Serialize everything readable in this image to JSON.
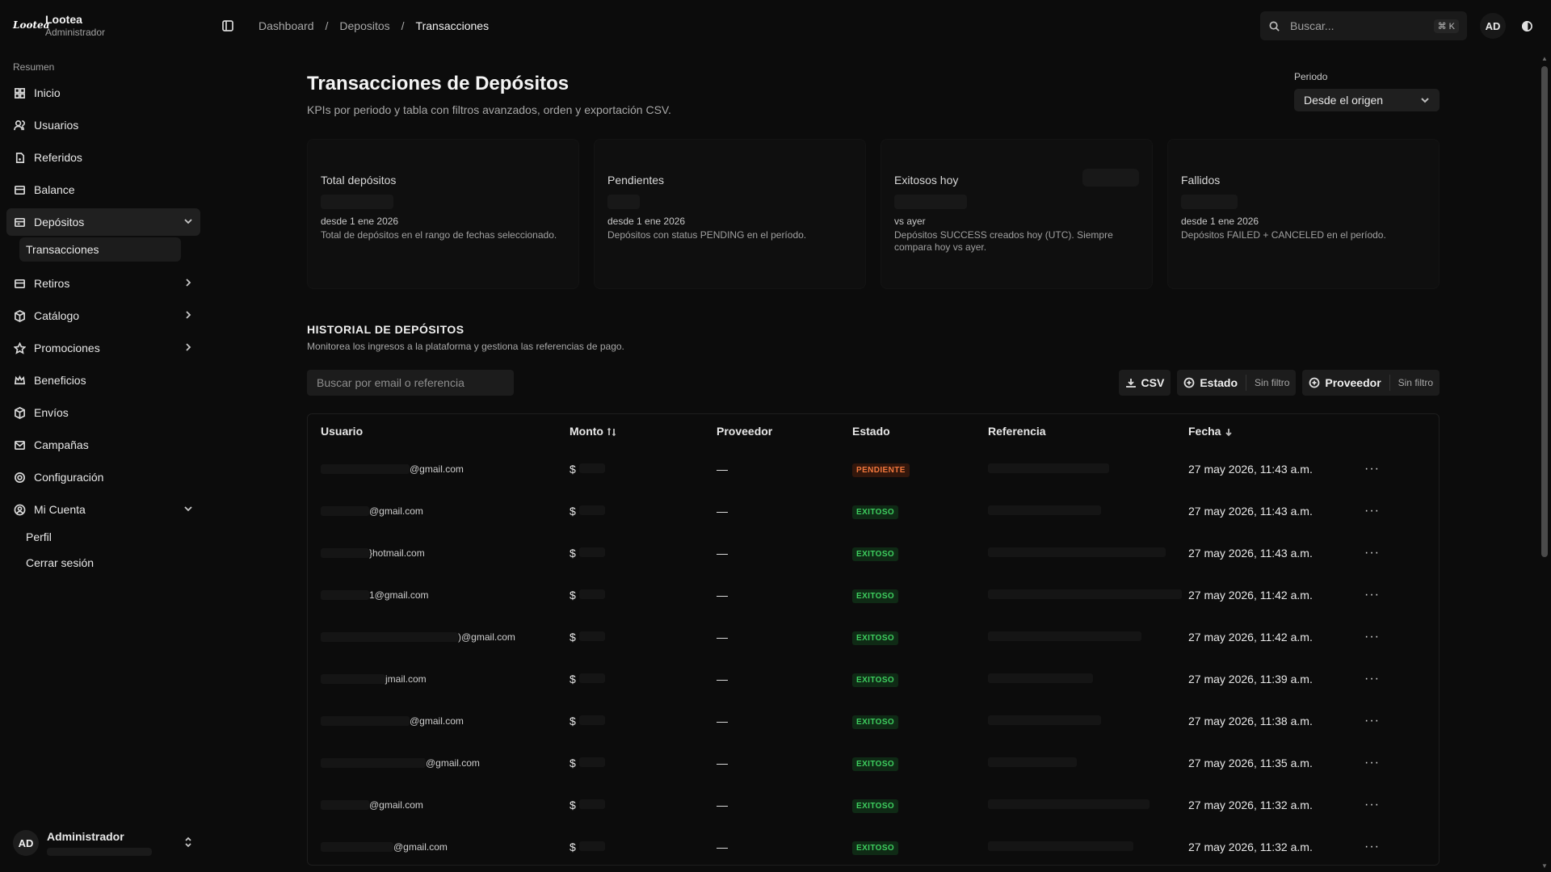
{
  "brand": {
    "logo": "Lootea",
    "name": "Lootea",
    "role": "Administrador"
  },
  "sidebar": {
    "section": "Resumen",
    "items": [
      {
        "label": "Inicio",
        "icon": "grid-icon"
      },
      {
        "label": "Usuarios",
        "icon": "users-icon"
      },
      {
        "label": "Referidos",
        "icon": "referral-icon"
      },
      {
        "label": "Balance",
        "icon": "wallet-icon"
      },
      {
        "label": "Depósitos",
        "icon": "card-icon"
      },
      {
        "label": "Retiros",
        "icon": "card-icon"
      },
      {
        "label": "Catálogo",
        "icon": "box-icon"
      },
      {
        "label": "Promociones",
        "icon": "star-icon"
      },
      {
        "label": "Beneficios",
        "icon": "crown-icon"
      },
      {
        "label": "Envíos",
        "icon": "package-icon"
      },
      {
        "label": "Campañas",
        "icon": "mail-icon"
      },
      {
        "label": "Configuración",
        "icon": "gear-icon"
      },
      {
        "label": "Mi Cuenta",
        "icon": "user-circle-icon"
      }
    ],
    "depositos_sub": [
      "Transacciones"
    ],
    "cuenta_sub": [
      "Perfil",
      "Cerrar sesión"
    ],
    "footer": {
      "avatar": "AD",
      "name": "Administrador"
    }
  },
  "topbar": {
    "breadcrumb": [
      "Dashboard",
      "Depositos",
      "Transacciones"
    ],
    "separator": "/",
    "search_placeholder": "Buscar...",
    "shortcut": "⌘ K",
    "avatar": "AD"
  },
  "main": {
    "title": "Transacciones de Depósitos",
    "subtitle": "KPIs por periodo y tabla con filtros avanzados, orden y exportación CSV.",
    "period": {
      "label": "Periodo",
      "value": "Desde el origen"
    },
    "kpis": [
      {
        "title": "Total depósitos",
        "meta": "desde 1 ene 2026",
        "desc": "Total de depósitos en el rango de fechas seleccionado."
      },
      {
        "title": "Pendientes",
        "meta": "desde 1 ene 2026",
        "desc": "Depósitos con status PENDING en el período."
      },
      {
        "title": "Exitosos hoy",
        "meta": "vs ayer",
        "desc": "Depósitos SUCCESS creados hoy (UTC). Siempre compara hoy vs ayer."
      },
      {
        "title": "Fallidos",
        "meta": "desde 1 ene 2026",
        "desc": "Depósitos FAILED + CANCELED en el período."
      }
    ],
    "history": {
      "title": "HISTORIAL DE DEPÓSITOS",
      "subtitle": "Monitorea los ingresos a la plataforma y gestiona las referencias de pago."
    },
    "toolbar": {
      "search_placeholder": "Buscar por email o referencia",
      "csv": "CSV",
      "estado": "Estado",
      "estado_filter": "Sin filtro",
      "proveedor": "Proveedor",
      "proveedor_filter": "Sin filtro"
    },
    "table": {
      "columns": [
        "Usuario",
        "Monto",
        "Proveedor",
        "Estado",
        "Referencia",
        "Fecha"
      ],
      "rows": [
        {
          "email": "@gmail.com",
          "amount": "$",
          "provider": "—",
          "status": "PENDIENTE",
          "status_type": "pending",
          "date": "27 may 2026, 11:43 a.m."
        },
        {
          "email": "@gmail.com",
          "amount": "$",
          "provider": "—",
          "status": "EXITOSO",
          "status_type": "success",
          "date": "27 may 2026, 11:43 a.m."
        },
        {
          "email": "}hotmail.com",
          "amount": "$",
          "provider": "—",
          "status": "EXITOSO",
          "status_type": "success",
          "date": "27 may 2026, 11:43 a.m."
        },
        {
          "email": "1@gmail.com",
          "amount": "$",
          "provider": "—",
          "status": "EXITOSO",
          "status_type": "success",
          "date": "27 may 2026, 11:42 a.m."
        },
        {
          "email": ")@gmail.com",
          "amount": "$",
          "provider": "—",
          "status": "EXITOSO",
          "status_type": "success",
          "date": "27 may 2026, 11:42 a.m."
        },
        {
          "email": "jmail.com",
          "amount": "$",
          "provider": "—",
          "status": "EXITOSO",
          "status_type": "success",
          "date": "27 may 2026, 11:39 a.m."
        },
        {
          "email": "@gmail.com",
          "amount": "$",
          "provider": "—",
          "status": "EXITOSO",
          "status_type": "success",
          "date": "27 may 2026, 11:38 a.m."
        },
        {
          "email": "@gmail.com",
          "amount": "$",
          "provider": "—",
          "status": "EXITOSO",
          "status_type": "success",
          "date": "27 may 2026, 11:35 a.m."
        },
        {
          "email": "@gmail.com",
          "amount": "$",
          "provider": "—",
          "status": "EXITOSO",
          "status_type": "success",
          "date": "27 may 2026, 11:32 a.m."
        },
        {
          "email": "@gmail.com",
          "amount": "$",
          "provider": "—",
          "status": "EXITOSO",
          "status_type": "success",
          "date": "27 may 2026, 11:32 a.m."
        }
      ],
      "row_action": "···"
    }
  },
  "colors": {
    "background": "#0c0c0c",
    "success": "#3ecf5f",
    "pending": "#f2773c",
    "scroll_thumb": "#4a4a4a"
  }
}
